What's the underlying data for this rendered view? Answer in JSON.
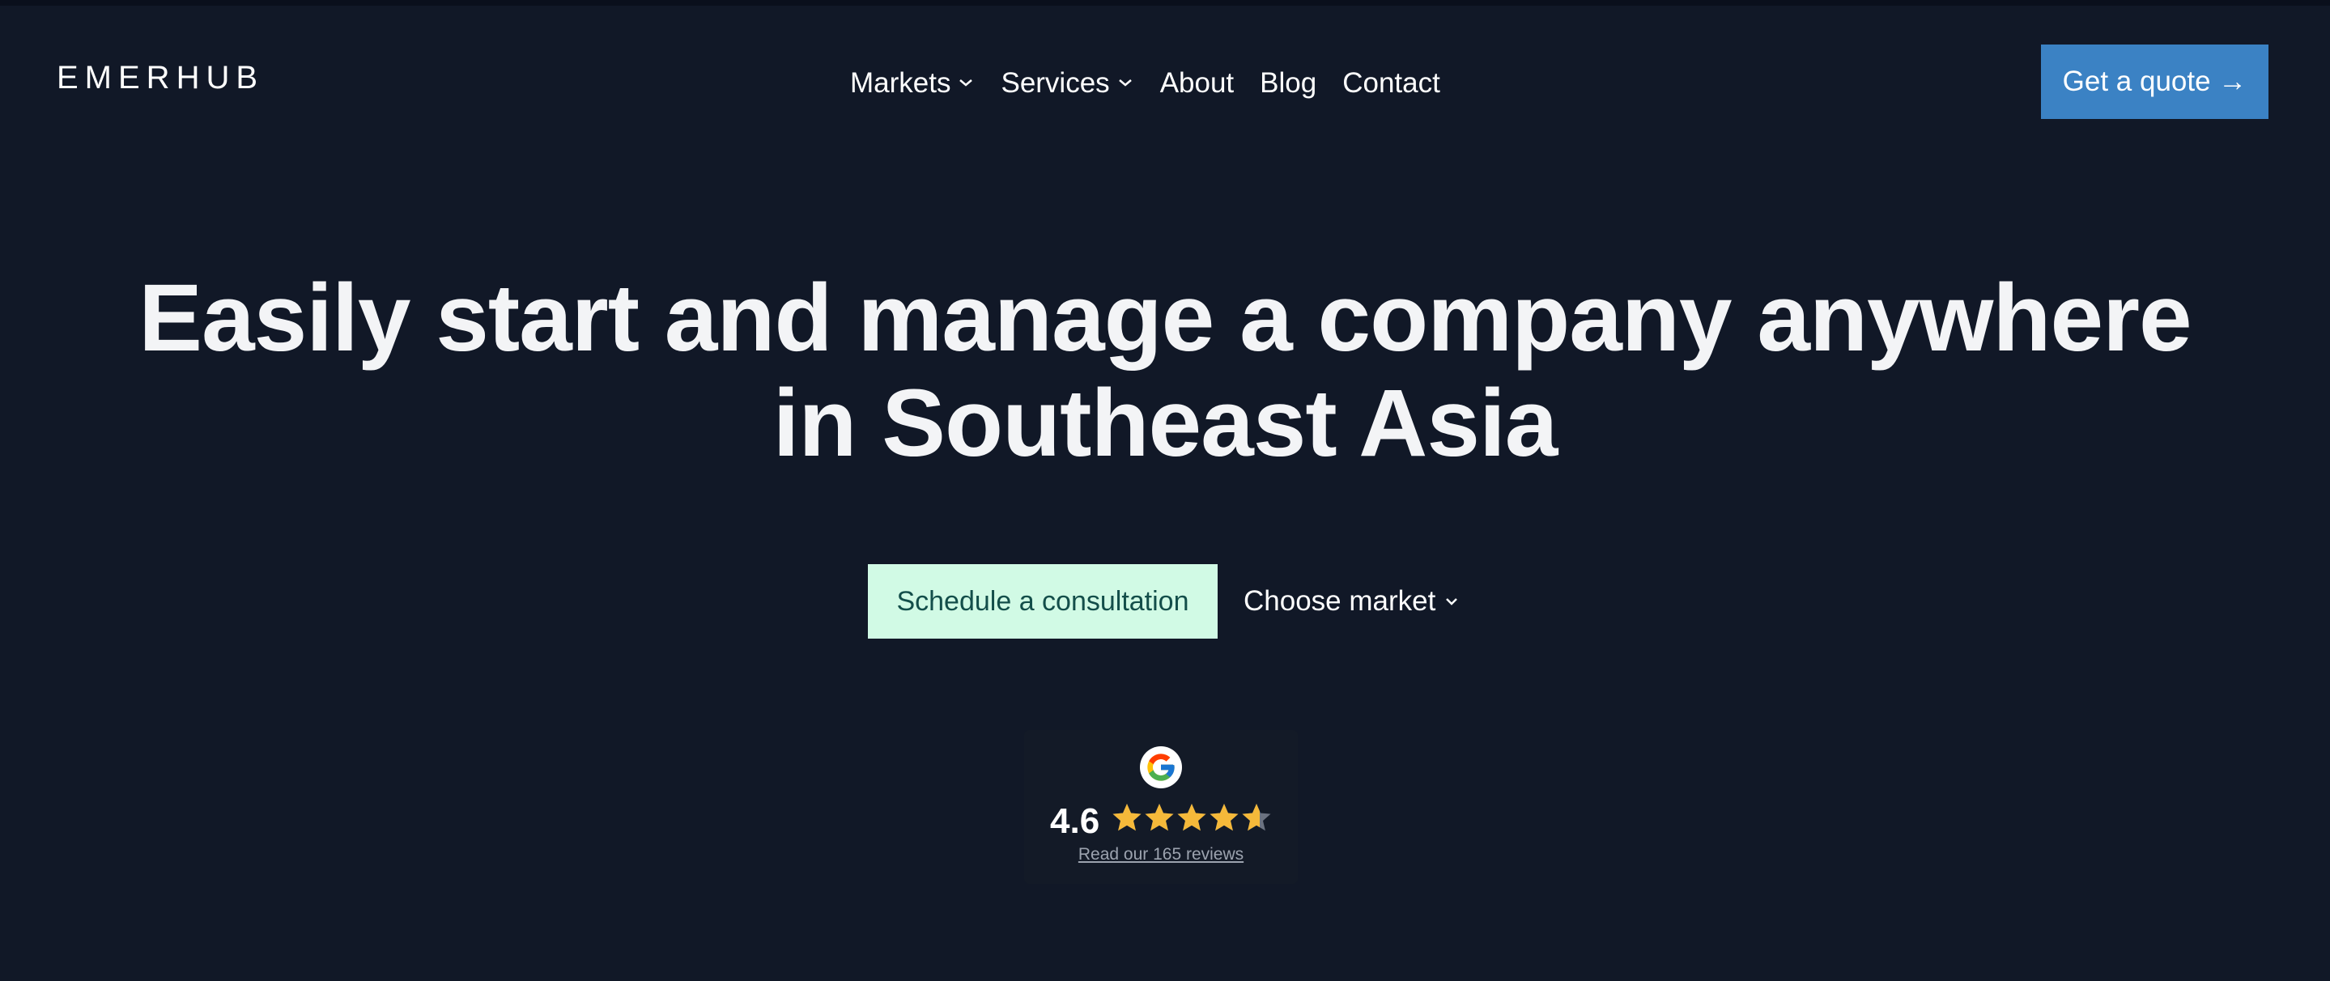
{
  "brand": {
    "logo_text": "EMERHUB"
  },
  "nav": {
    "items": [
      {
        "label": "Markets",
        "has_dropdown": true
      },
      {
        "label": "Services",
        "has_dropdown": true
      },
      {
        "label": "About",
        "has_dropdown": false
      },
      {
        "label": "Blog",
        "has_dropdown": false
      },
      {
        "label": "Contact",
        "has_dropdown": false
      }
    ],
    "quote_button": "Get a quote →"
  },
  "hero": {
    "title_line1": "Easily start and manage a company anywhere",
    "title_line2": "in Southeast Asia",
    "consult_button": "Schedule a consultation",
    "market_dropdown": "Choose market"
  },
  "reviews": {
    "rating": "4.6",
    "rating_value": 4.6,
    "stars_max": 5,
    "link_text": "Read our 165 reviews",
    "icon": "google-g-icon"
  },
  "colors": {
    "background": "#111827",
    "quote_button": "#3b82c4",
    "consult_button": "#d1fae5",
    "star": "#f5b93a"
  }
}
